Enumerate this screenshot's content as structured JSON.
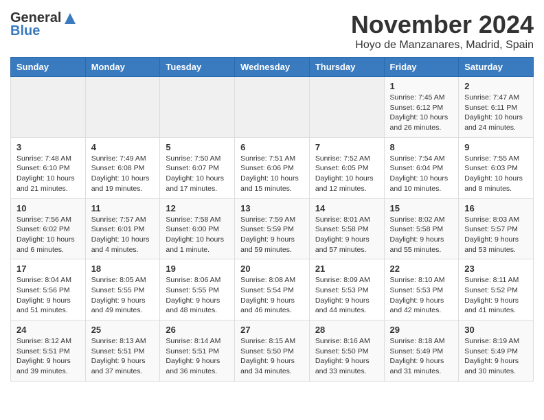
{
  "logo": {
    "general": "General",
    "blue": "Blue"
  },
  "header": {
    "month": "November 2024",
    "location": "Hoyo de Manzanares, Madrid, Spain"
  },
  "columns": [
    "Sunday",
    "Monday",
    "Tuesday",
    "Wednesday",
    "Thursday",
    "Friday",
    "Saturday"
  ],
  "weeks": [
    [
      {
        "day": "",
        "info": ""
      },
      {
        "day": "",
        "info": ""
      },
      {
        "day": "",
        "info": ""
      },
      {
        "day": "",
        "info": ""
      },
      {
        "day": "",
        "info": ""
      },
      {
        "day": "1",
        "info": "Sunrise: 7:45 AM\nSunset: 6:12 PM\nDaylight: 10 hours and 26 minutes."
      },
      {
        "day": "2",
        "info": "Sunrise: 7:47 AM\nSunset: 6:11 PM\nDaylight: 10 hours and 24 minutes."
      }
    ],
    [
      {
        "day": "3",
        "info": "Sunrise: 7:48 AM\nSunset: 6:10 PM\nDaylight: 10 hours and 21 minutes."
      },
      {
        "day": "4",
        "info": "Sunrise: 7:49 AM\nSunset: 6:08 PM\nDaylight: 10 hours and 19 minutes."
      },
      {
        "day": "5",
        "info": "Sunrise: 7:50 AM\nSunset: 6:07 PM\nDaylight: 10 hours and 17 minutes."
      },
      {
        "day": "6",
        "info": "Sunrise: 7:51 AM\nSunset: 6:06 PM\nDaylight: 10 hours and 15 minutes."
      },
      {
        "day": "7",
        "info": "Sunrise: 7:52 AM\nSunset: 6:05 PM\nDaylight: 10 hours and 12 minutes."
      },
      {
        "day": "8",
        "info": "Sunrise: 7:54 AM\nSunset: 6:04 PM\nDaylight: 10 hours and 10 minutes."
      },
      {
        "day": "9",
        "info": "Sunrise: 7:55 AM\nSunset: 6:03 PM\nDaylight: 10 hours and 8 minutes."
      }
    ],
    [
      {
        "day": "10",
        "info": "Sunrise: 7:56 AM\nSunset: 6:02 PM\nDaylight: 10 hours and 6 minutes."
      },
      {
        "day": "11",
        "info": "Sunrise: 7:57 AM\nSunset: 6:01 PM\nDaylight: 10 hours and 4 minutes."
      },
      {
        "day": "12",
        "info": "Sunrise: 7:58 AM\nSunset: 6:00 PM\nDaylight: 10 hours and 1 minute."
      },
      {
        "day": "13",
        "info": "Sunrise: 7:59 AM\nSunset: 5:59 PM\nDaylight: 9 hours and 59 minutes."
      },
      {
        "day": "14",
        "info": "Sunrise: 8:01 AM\nSunset: 5:58 PM\nDaylight: 9 hours and 57 minutes."
      },
      {
        "day": "15",
        "info": "Sunrise: 8:02 AM\nSunset: 5:58 PM\nDaylight: 9 hours and 55 minutes."
      },
      {
        "day": "16",
        "info": "Sunrise: 8:03 AM\nSunset: 5:57 PM\nDaylight: 9 hours and 53 minutes."
      }
    ],
    [
      {
        "day": "17",
        "info": "Sunrise: 8:04 AM\nSunset: 5:56 PM\nDaylight: 9 hours and 51 minutes."
      },
      {
        "day": "18",
        "info": "Sunrise: 8:05 AM\nSunset: 5:55 PM\nDaylight: 9 hours and 49 minutes."
      },
      {
        "day": "19",
        "info": "Sunrise: 8:06 AM\nSunset: 5:55 PM\nDaylight: 9 hours and 48 minutes."
      },
      {
        "day": "20",
        "info": "Sunrise: 8:08 AM\nSunset: 5:54 PM\nDaylight: 9 hours and 46 minutes."
      },
      {
        "day": "21",
        "info": "Sunrise: 8:09 AM\nSunset: 5:53 PM\nDaylight: 9 hours and 44 minutes."
      },
      {
        "day": "22",
        "info": "Sunrise: 8:10 AM\nSunset: 5:53 PM\nDaylight: 9 hours and 42 minutes."
      },
      {
        "day": "23",
        "info": "Sunrise: 8:11 AM\nSunset: 5:52 PM\nDaylight: 9 hours and 41 minutes."
      }
    ],
    [
      {
        "day": "24",
        "info": "Sunrise: 8:12 AM\nSunset: 5:51 PM\nDaylight: 9 hours and 39 minutes."
      },
      {
        "day": "25",
        "info": "Sunrise: 8:13 AM\nSunset: 5:51 PM\nDaylight: 9 hours and 37 minutes."
      },
      {
        "day": "26",
        "info": "Sunrise: 8:14 AM\nSunset: 5:51 PM\nDaylight: 9 hours and 36 minutes."
      },
      {
        "day": "27",
        "info": "Sunrise: 8:15 AM\nSunset: 5:50 PM\nDaylight: 9 hours and 34 minutes."
      },
      {
        "day": "28",
        "info": "Sunrise: 8:16 AM\nSunset: 5:50 PM\nDaylight: 9 hours and 33 minutes."
      },
      {
        "day": "29",
        "info": "Sunrise: 8:18 AM\nSunset: 5:49 PM\nDaylight: 9 hours and 31 minutes."
      },
      {
        "day": "30",
        "info": "Sunrise: 8:19 AM\nSunset: 5:49 PM\nDaylight: 9 hours and 30 minutes."
      }
    ]
  ]
}
